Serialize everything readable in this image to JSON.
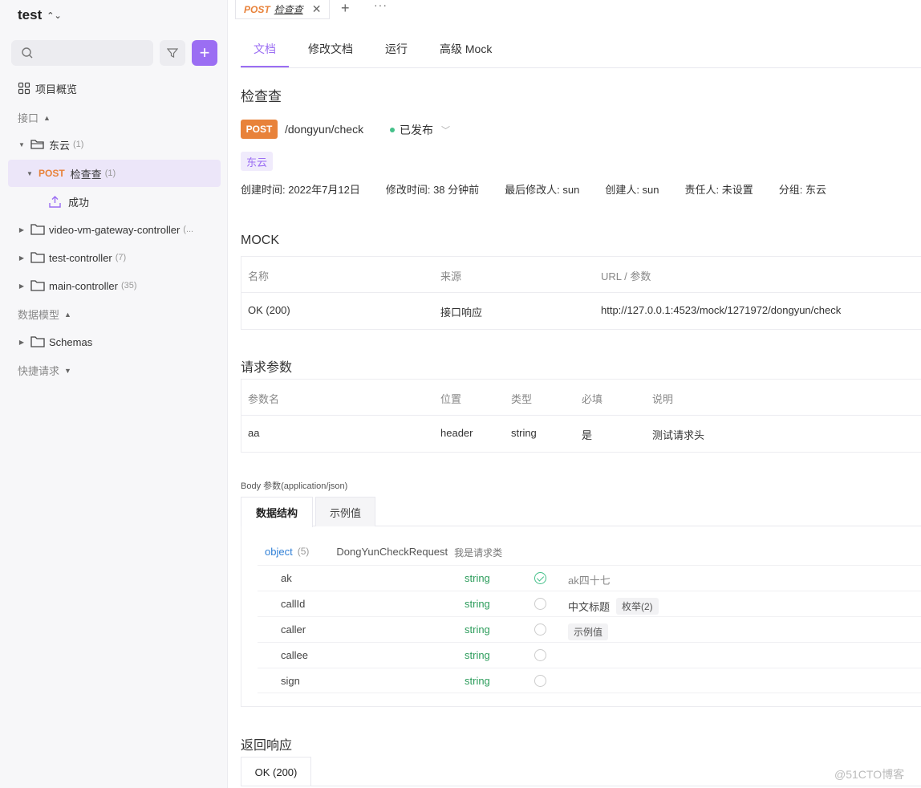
{
  "sidebar": {
    "project_name": "test",
    "items": {
      "overview": "项目概览",
      "section_api": "接口",
      "folder_dongyun": {
        "label": "东云",
        "count": "(1)"
      },
      "api_check": {
        "method": "POST",
        "label": "检查查",
        "count": "(1)"
      },
      "case_success": "成功",
      "folder_video": {
        "label": "video-vm-gateway-controller",
        "count": "(..."
      },
      "folder_test": {
        "label": "test-controller",
        "count": "(7)"
      },
      "folder_main": {
        "label": "main-controller",
        "count": "(35)"
      },
      "section_models": "数据模型",
      "folder_schemas": "Schemas",
      "section_quick": "快捷请求"
    }
  },
  "tabbar": {
    "active_method": "POST",
    "active_title": "检查查",
    "close": "✕",
    "add": "+",
    "more": "···"
  },
  "subtabs": [
    "文档",
    "修改文档",
    "运行",
    "高级 Mock"
  ],
  "api": {
    "title": "检查查",
    "method": "POST",
    "path": "/dongyun/check",
    "status": "已发布",
    "tag": "东云",
    "meta": [
      "创建时间: 2022年7月12日",
      "修改时间: 38 分钟前",
      "最后修改人: sun",
      "创建人: sun",
      "责任人: 未设置",
      "分组: 东云"
    ]
  },
  "mock": {
    "heading": "MOCK",
    "headers": [
      "名称",
      "来源",
      "URL / 参数"
    ],
    "rows": [
      [
        "OK (200)",
        "接口响应",
        "http://127.0.0.1:4523/mock/1271972/dongyun/check"
      ]
    ]
  },
  "params": {
    "heading": "请求参数",
    "headers": [
      "参数名",
      "位置",
      "类型",
      "必填",
      "说明"
    ],
    "rows": [
      [
        "aa",
        "header",
        "string",
        "是",
        "测试请求头"
      ]
    ]
  },
  "body": {
    "label": "Body 参数(application/json)",
    "tabs": [
      "数据结构",
      "示例值"
    ],
    "object": {
      "type": "object",
      "count": "(5)",
      "name": "DongYunCheckRequest",
      "desc": "我是请求类"
    },
    "fields": [
      {
        "name": "ak",
        "type": "string",
        "required": true,
        "desc": "ak四十七",
        "chip": ""
      },
      {
        "name": "callId",
        "type": "string",
        "required": false,
        "desc": "中文标题",
        "chip": "枚举(2)"
      },
      {
        "name": "caller",
        "type": "string",
        "required": false,
        "desc": "",
        "chip": "示例值"
      },
      {
        "name": "callee",
        "type": "string",
        "required": false,
        "desc": "",
        "chip": ""
      },
      {
        "name": "sign",
        "type": "string",
        "required": false,
        "desc": "",
        "chip": ""
      }
    ]
  },
  "response": {
    "heading": "返回响应",
    "tab": "OK (200)"
  },
  "watermark": "@51CTO博客",
  "colors": {
    "accent": "#9b6ef3",
    "post": "#e8823a",
    "string_type": "#2d9d5c",
    "published": "#45c08a"
  }
}
